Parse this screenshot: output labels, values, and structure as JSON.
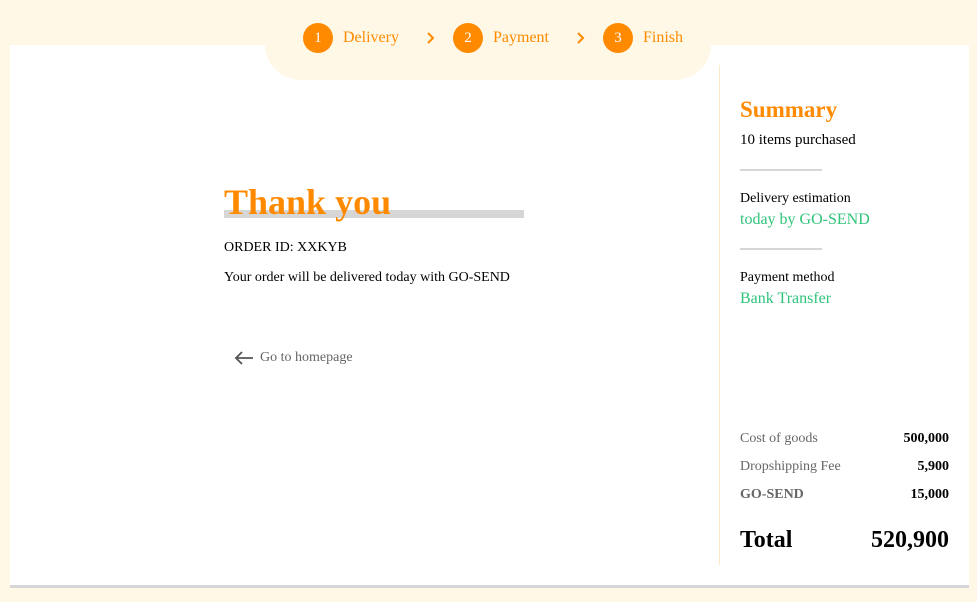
{
  "stepper": {
    "steps": [
      {
        "number": "1",
        "label": "Delivery"
      },
      {
        "number": "2",
        "label": "Payment"
      },
      {
        "number": "3",
        "label": "Finish"
      }
    ]
  },
  "main": {
    "title": "Thank you",
    "order_id": "ORDER ID: XXKYB",
    "message": "Your order will be delivered today with GO-SEND",
    "home_link": "Go to homepage"
  },
  "summary": {
    "title": "Summary",
    "items_purchased": "10 items purchased",
    "delivery_label": "Delivery estimation",
    "delivery_value": "today by GO-SEND",
    "payment_label": "Payment method",
    "payment_value": "Bank Transfer",
    "costs": [
      {
        "label": "Cost of goods",
        "value": "500,000"
      },
      {
        "label": "Dropshipping Fee",
        "value": "5,900"
      },
      {
        "label": "GO-SEND",
        "value": "15,000"
      }
    ],
    "total_label": "Total",
    "total_value": "520,900"
  },
  "colors": {
    "accent": "#ff8a00",
    "success": "#2fc47a",
    "background": "#fff8e6"
  }
}
